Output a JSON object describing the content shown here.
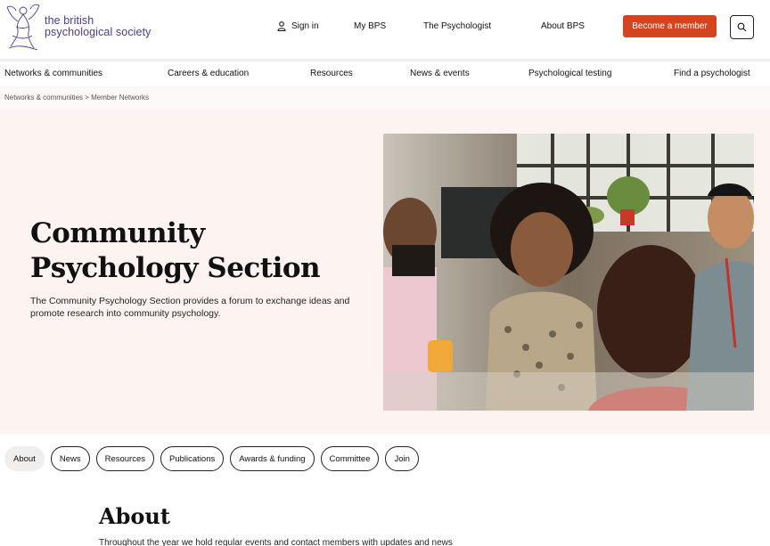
{
  "header": {
    "logo_line1": "the british",
    "logo_line2": "psychological society",
    "sign_in": "Sign in",
    "my_bps": "My BPS",
    "the_psychologist": "The Psychologist",
    "about_bps": "About BPS",
    "become_member": "Become a member",
    "brand_color": "#d4451f",
    "logo_color": "#4b3a8f"
  },
  "main_nav": {
    "items": [
      "Networks & communities",
      "Careers & education",
      "Resources",
      "News & events",
      "Psychological testing",
      "Find a psychologist"
    ]
  },
  "breadcrumb": "Networks & communities > Member Networks",
  "hero": {
    "title_line1": "Community",
    "title_line2": "Psychology Section",
    "description": "The Community Psychology Section provides a forum to exchange ideas and promote research into community psychology.",
    "image_alt": "group-of-people-talking-photo"
  },
  "tabs": [
    "About",
    "News",
    "Resources",
    "Publications",
    "Awards & funding",
    "Committee",
    "Join"
  ],
  "about": {
    "title": "About",
    "text": "Throughout the year we hold regular events and contact members with updates and news"
  }
}
